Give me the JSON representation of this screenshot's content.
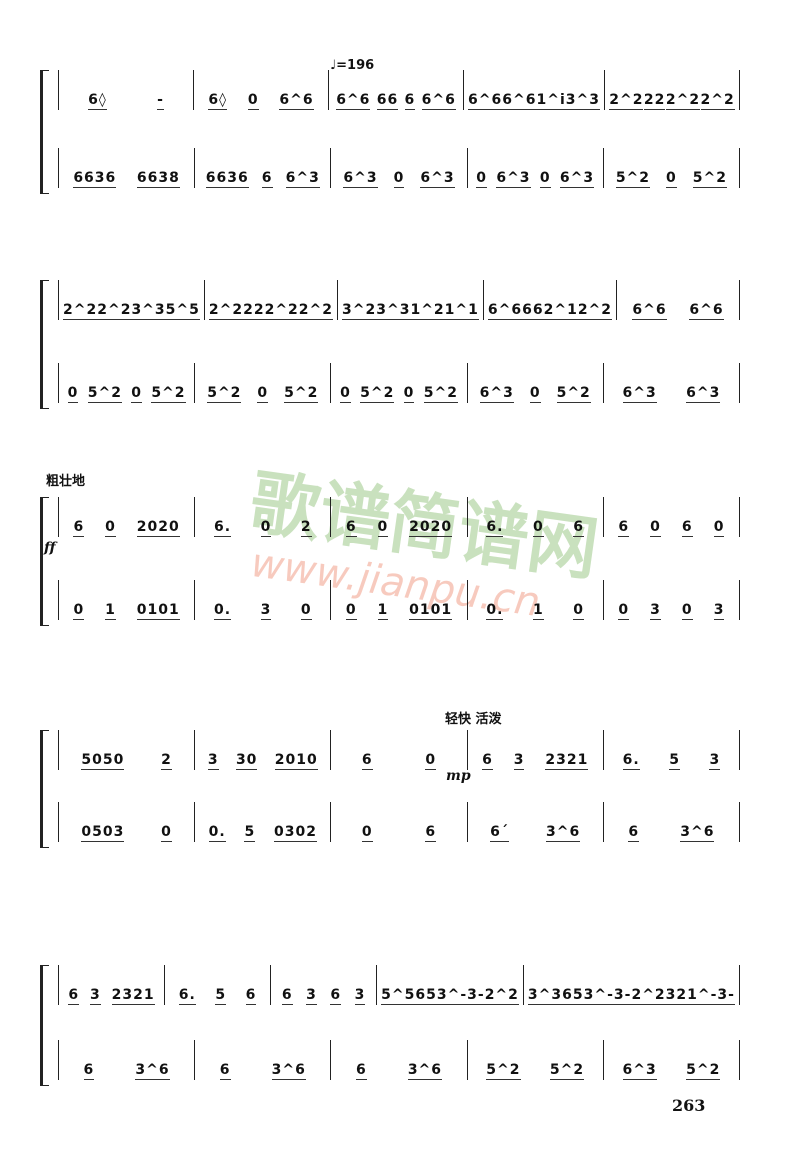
{
  "tempo": "♩=196",
  "watermark": {
    "text": "歌谱简谱网",
    "url": "www.jianpu.cn"
  },
  "page_number": "263",
  "systems": [
    {
      "upper": [
        [
          "6◊",
          "-"
        ],
        [
          "6◊",
          "0",
          "6^6"
        ],
        [
          "6^6",
          "66",
          "6",
          "6^6"
        ],
        [
          "6^6",
          "6^6",
          "1^i",
          "3^3"
        ],
        [
          "2^2",
          "22",
          "2^2",
          "2^2"
        ]
      ],
      "lower": [
        [
          "6636",
          "6638"
        ],
        [
          "6636",
          "6",
          "6^3"
        ],
        [
          "6^3",
          "0",
          "6^3"
        ],
        [
          "0",
          "6^3",
          "0",
          "6^3"
        ],
        [
          "5^2",
          "0",
          "5^2"
        ]
      ]
    },
    {
      "upper": [
        [
          "2^2",
          "2^2",
          "3^3",
          "5^5"
        ],
        [
          "2^2",
          "22",
          "2^2",
          "2^2"
        ],
        [
          "3^2",
          "3^3",
          "1^2",
          "1^1"
        ],
        [
          "6^6",
          "66",
          "2^1",
          "2^2"
        ],
        [
          "6^6",
          "6^6"
        ]
      ],
      "lower": [
        [
          "0",
          "5^2",
          "0",
          "5^2"
        ],
        [
          "5^2",
          "0",
          "5^2"
        ],
        [
          "0",
          "5^2",
          "0",
          "5^2"
        ],
        [
          "6^3",
          "0",
          "5^2"
        ],
        [
          "6^3",
          "6^3"
        ]
      ]
    },
    {
      "label": "粗壮地",
      "dynamic": "ff",
      "upper": [
        [
          "6",
          "0",
          "2020"
        ],
        [
          "6.",
          "0",
          "2"
        ],
        [
          "6",
          "0",
          "2020"
        ],
        [
          "6.",
          "0",
          "6"
        ],
        [
          "6",
          "0",
          "6",
          "0"
        ]
      ],
      "lower": [
        [
          "0",
          "1",
          "0101"
        ],
        [
          "0.",
          "3",
          "0"
        ],
        [
          "0",
          "1",
          "0101"
        ],
        [
          "0.",
          "1",
          "0"
        ],
        [
          "0",
          "3",
          "0",
          "3"
        ]
      ]
    },
    {
      "label": "轻快  活泼",
      "dynamic": "mp",
      "upper": [
        [
          "5050",
          "2"
        ],
        [
          "3",
          "30",
          "2010"
        ],
        [
          "6",
          "0"
        ],
        [
          "6",
          "3",
          "2321"
        ],
        [
          "6.",
          "5",
          "3"
        ]
      ],
      "lower": [
        [
          "0503",
          "0"
        ],
        [
          "0.",
          "5",
          "0302"
        ],
        [
          "0",
          "6"
        ],
        [
          "6´",
          "3^6"
        ],
        [
          "6",
          "3^6"
        ]
      ]
    },
    {
      "upper": [
        [
          "6",
          "3",
          "2321"
        ],
        [
          "6.",
          "5",
          "6"
        ],
        [
          "6",
          "3",
          "6",
          "3"
        ],
        [
          "5^5",
          "653^-3-",
          "2^2"
        ],
        [
          "3^3",
          "653^-3-",
          "2^2",
          "321^-3-"
        ]
      ],
      "lower": [
        [
          "6",
          "3^6"
        ],
        [
          "6",
          "3^6"
        ],
        [
          "6",
          "3^6"
        ],
        [
          "5^2",
          "5^2"
        ],
        [
          "6^3",
          "5^2"
        ]
      ]
    }
  ]
}
